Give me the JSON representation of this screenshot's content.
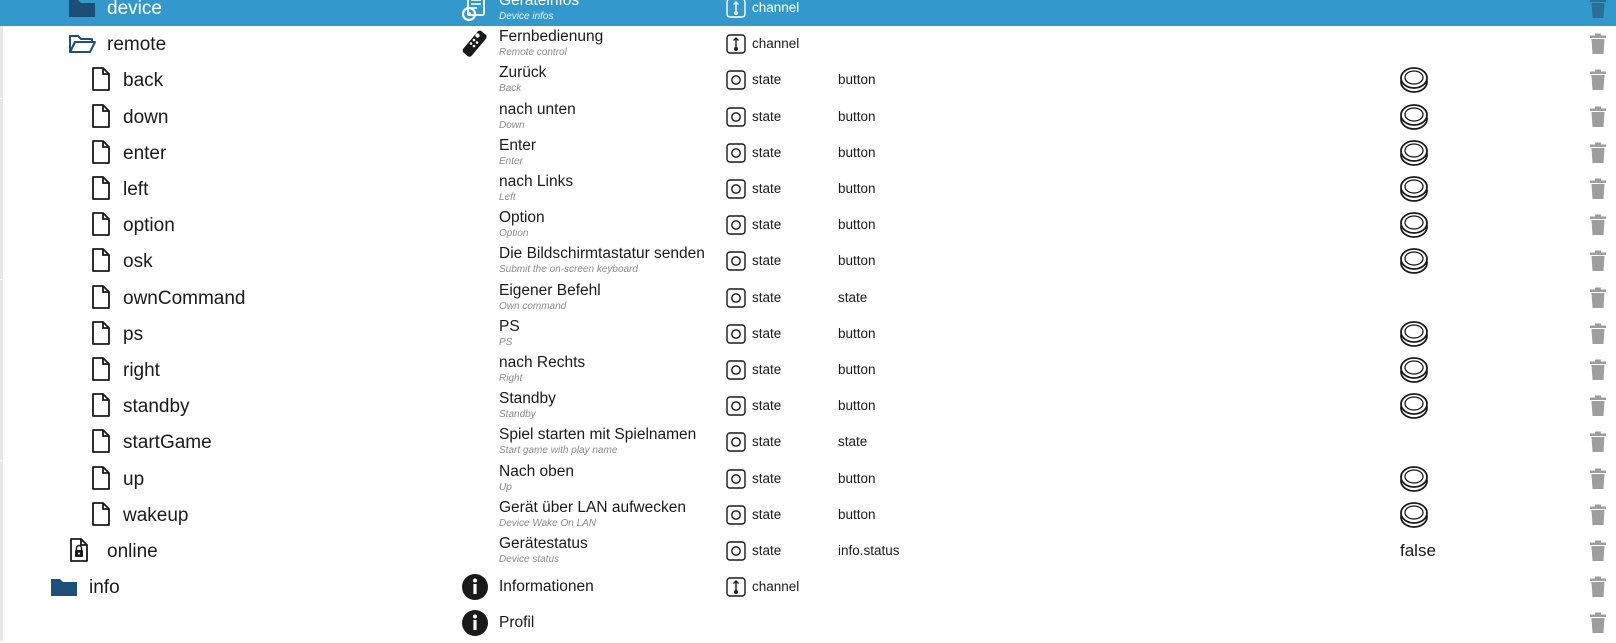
{
  "rows": [
    {
      "id": "device",
      "name": "device",
      "kind": "folder",
      "depth": 2,
      "title": "Geräteinfos",
      "subtitle": "Device infos",
      "type": "channel",
      "role": "",
      "value": "",
      "selected": true,
      "roleIcon": "gear-document-icon"
    },
    {
      "id": "remote",
      "name": "remote",
      "kind": "folder-open",
      "depth": 2,
      "title": "Fernbedienung",
      "subtitle": "Remote control",
      "type": "channel",
      "role": "",
      "value": "",
      "selected": false,
      "roleIcon": "remote-control-icon"
    },
    {
      "id": "back",
      "name": "back",
      "kind": "file",
      "depth": 3,
      "title": "Zurück",
      "subtitle": "Back",
      "type": "state",
      "role": "button",
      "value": "button",
      "selected": false
    },
    {
      "id": "down",
      "name": "down",
      "kind": "file",
      "depth": 3,
      "title": "nach unten",
      "subtitle": "Down",
      "type": "state",
      "role": "button",
      "value": "button",
      "selected": false
    },
    {
      "id": "enter",
      "name": "enter",
      "kind": "file",
      "depth": 3,
      "title": "Enter",
      "subtitle": "Enter",
      "type": "state",
      "role": "button",
      "value": "button",
      "selected": false
    },
    {
      "id": "left",
      "name": "left",
      "kind": "file",
      "depth": 3,
      "title": "nach Links",
      "subtitle": "Left",
      "type": "state",
      "role": "button",
      "value": "button",
      "selected": false
    },
    {
      "id": "option",
      "name": "option",
      "kind": "file",
      "depth": 3,
      "title": "Option",
      "subtitle": "Option",
      "type": "state",
      "role": "button",
      "value": "button",
      "selected": false
    },
    {
      "id": "osk",
      "name": "osk",
      "kind": "file",
      "depth": 3,
      "title": "Die Bildschirmtastatur senden",
      "subtitle": "Submit the on-screen keyboard",
      "type": "state",
      "role": "button",
      "value": "button",
      "selected": false
    },
    {
      "id": "ownCommand",
      "name": "ownCommand",
      "kind": "file",
      "depth": 3,
      "title": "Eigener Befehl",
      "subtitle": "Own command",
      "type": "state",
      "role": "state",
      "value": "",
      "selected": false
    },
    {
      "id": "ps",
      "name": "ps",
      "kind": "file",
      "depth": 3,
      "title": "PS",
      "subtitle": "PS",
      "type": "state",
      "role": "button",
      "value": "button",
      "selected": false
    },
    {
      "id": "right",
      "name": "right",
      "kind": "file",
      "depth": 3,
      "title": "nach Rechts",
      "subtitle": "Right",
      "type": "state",
      "role": "button",
      "value": "button",
      "selected": false
    },
    {
      "id": "standby",
      "name": "standby",
      "kind": "file",
      "depth": 3,
      "title": "Standby",
      "subtitle": "Standby",
      "type": "state",
      "role": "button",
      "value": "button",
      "selected": false
    },
    {
      "id": "startGame",
      "name": "startGame",
      "kind": "file",
      "depth": 3,
      "title": "Spiel starten mit Spielnamen",
      "subtitle": "Start game with play name",
      "type": "state",
      "role": "state",
      "value": "",
      "selected": false
    },
    {
      "id": "up",
      "name": "up",
      "kind": "file",
      "depth": 3,
      "title": "Nach oben",
      "subtitle": "Up",
      "type": "state",
      "role": "button",
      "value": "button",
      "selected": false
    },
    {
      "id": "wakeup",
      "name": "wakeup",
      "kind": "file",
      "depth": 3,
      "title": "Gerät über LAN aufwecken",
      "subtitle": "Device Wake On LAN",
      "type": "state",
      "role": "button",
      "value": "button",
      "selected": false
    },
    {
      "id": "online",
      "name": "online",
      "kind": "file-lock",
      "depth": 2,
      "title": "Gerätestatus",
      "subtitle": "Device status",
      "type": "state",
      "role": "info.status",
      "value": "false",
      "selected": false
    },
    {
      "id": "info",
      "name": "info",
      "kind": "folder",
      "depth": 1,
      "title": "Informationen",
      "subtitle": "",
      "type": "channel",
      "role": "",
      "value": "",
      "selected": false,
      "roleIcon": "info-icon"
    },
    {
      "id": "profile",
      "name": "",
      "kind": "none",
      "depth": 1,
      "title": "Profil",
      "subtitle": "",
      "type": "",
      "role": "",
      "value": "",
      "selected": false,
      "roleIcon": "info-icon"
    }
  ],
  "colors": {
    "selected_bg": "#3399cc",
    "folder": "#1f4f7c",
    "trash": "#9e9e9e",
    "subtitle": "#8a8a8a"
  }
}
